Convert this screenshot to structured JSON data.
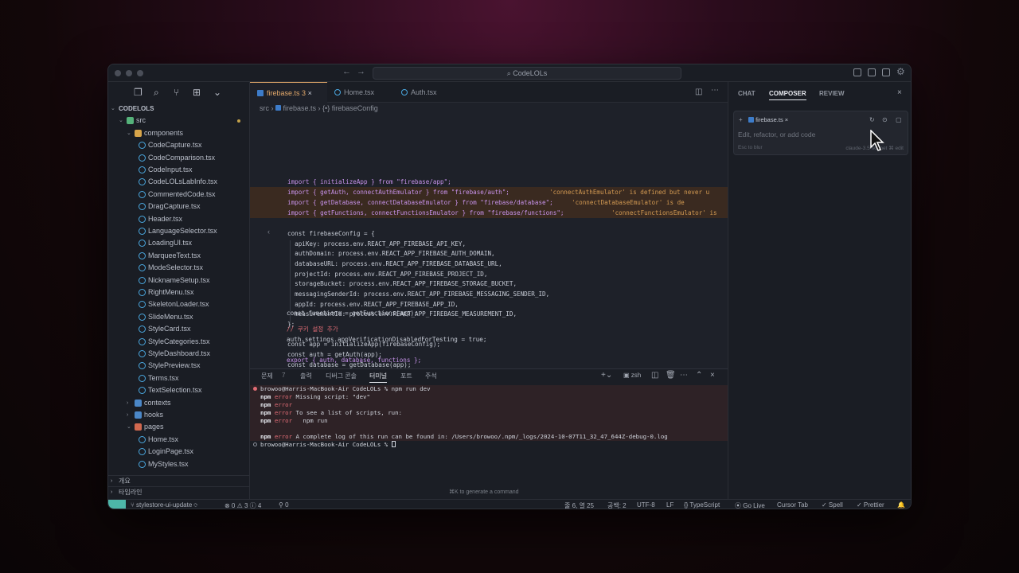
{
  "window": {
    "search_label": "⌕ CodeLOLs"
  },
  "explorer": {
    "root": "CODELOLS",
    "src": "src",
    "components": "components",
    "files": [
      "CodeCapture.tsx",
      "CodeComparison.tsx",
      "CodeInput.tsx",
      "CodeLOLsLabInfo.tsx",
      "CommentedCode.tsx",
      "DragCapture.tsx",
      "Header.tsx",
      "LanguageSelector.tsx",
      "LoadingUI.tsx",
      "MarqueeText.tsx",
      "ModeSelector.tsx",
      "NicknameSetup.tsx",
      "RightMenu.tsx",
      "SkeletonLoader.tsx",
      "SlideMenu.tsx",
      "StyleCard.tsx",
      "StyleCategories.tsx",
      "StyleDashboard.tsx",
      "StylePreview.tsx",
      "Terms.tsx",
      "TextSelection.tsx"
    ],
    "contexts": "contexts",
    "hooks": "hooks",
    "pages": "pages",
    "page_files": [
      "Home.tsx",
      "LoginPage.tsx",
      "MyStyles.tsx"
    ],
    "outline": "개요",
    "timeline": "타임라인"
  },
  "tabs": [
    {
      "label": "firebase.ts",
      "badge": "3",
      "close": "×"
    },
    {
      "label": "Home.tsx"
    },
    {
      "label": "Auth.tsx"
    }
  ],
  "breadcrumb": {
    "a": "src",
    "b": "firebase.ts",
    "c": "{•} firebaseConfig"
  },
  "code": {
    "l1": "import { initializeApp } from \"firebase/app\";",
    "l2a": "import { getAuth, connectAuthEmulator } from \"firebase/auth\";",
    "l2b": "'connectAuthEmulator' is defined but never u",
    "l3a": "import { getDatabase, connectDatabaseEmulator } from \"firebase/database\";",
    "l3b": "'connectDatabaseEmulator' is de",
    "l4a": "import { getFunctions, connectFunctionsEmulator } from \"firebase/functions\";",
    "l4b": "'connectFunctionsEmulator' is",
    "l5": "const firebaseConfig = {",
    "l6": "  apiKey: process.env.REACT_APP_FIREBASE_API_KEY,",
    "l7": "  authDomain: process.env.REACT_APP_FIREBASE_AUTH_DOMAIN,",
    "l8": "  databaseURL: process.env.REACT_APP_FIREBASE_DATABASE_URL,",
    "l9": "  projectId: process.env.REACT_APP_FIREBASE_PROJECT_ID,",
    "l10": "  storageBucket: process.env.REACT_APP_FIREBASE_STORAGE_BUCKET,",
    "l11": "  messagingSenderId: process.env.REACT_APP_FIREBASE_MESSAGING_SENDER_ID,",
    "l12": "  appId: process.env.REACT_APP_FIREBASE_APP_ID,",
    "l13": "  measurementId: process.env.REACT_APP_FIREBASE_MEASUREMENT_ID,",
    "l14": "};",
    "l15": "const app = initializeApp(firebaseConfig);",
    "l16": "const auth = getAuth(app);",
    "l17": "const database = getDatabase(app);",
    "l18": "const functions = getFunctions(app);",
    "l19": "// 쿠키 설정 추가",
    "l20": "auth.settings.appVerificationDisabledForTesting = true;",
    "l21": "export { auth, database, functions };"
  },
  "terminal": {
    "tabs": [
      "문제",
      "7",
      "출력",
      "디버그 콘솔",
      "터미널",
      "포트",
      "주석"
    ],
    "shell": "zsh",
    "lines": {
      "t1": "browoo@Harris-MacBook-Air CodeLOLs % npm run dev",
      "t2_a": "npm",
      "t2_b": "error",
      "t2_c": " Missing script: \"dev\"",
      "t3_a": "npm",
      "t3_b": "error",
      "t4_a": "npm",
      "t4_b": "error",
      "t4_c": " To see a list of scripts, run:",
      "t5_a": "npm",
      "t5_b": "error",
      "t5_c": "   npm run",
      "t6_a": "npm",
      "t6_b": "error",
      "t6_c": " A complete log of this run can be found in: /Users/browoo/.npm/_logs/2024-10-07T11_32_47_644Z-debug-0.log",
      "t7": "browoo@Harris-MacBook-Air CodeLOLs % "
    },
    "hint": "⌘K to generate a command"
  },
  "rpanel": {
    "tabs": [
      "CHAT",
      "COMPOSER",
      "REVIEW"
    ],
    "chip": "firebase.ts",
    "placeholder": "Edit, refactor, or add code",
    "esc": "Esc to blur",
    "mini": "claude-3.5-sonnet   ⌘ edit"
  },
  "status": {
    "branch": "stylestore-ui-update",
    "problems": "⊗ 0 ⚠ 3 ⓘ 4",
    "ports": "⚲ 0",
    "position": "줄 6, 열 25",
    "spaces": "공백: 2",
    "encoding": "UTF-8",
    "eol": "LF",
    "language": "{} TypeScript",
    "golive": "⦿ Go Live",
    "cursortab": "Cursor Tab",
    "spell": "✓ Spell",
    "prettier": "✓ Prettier"
  }
}
